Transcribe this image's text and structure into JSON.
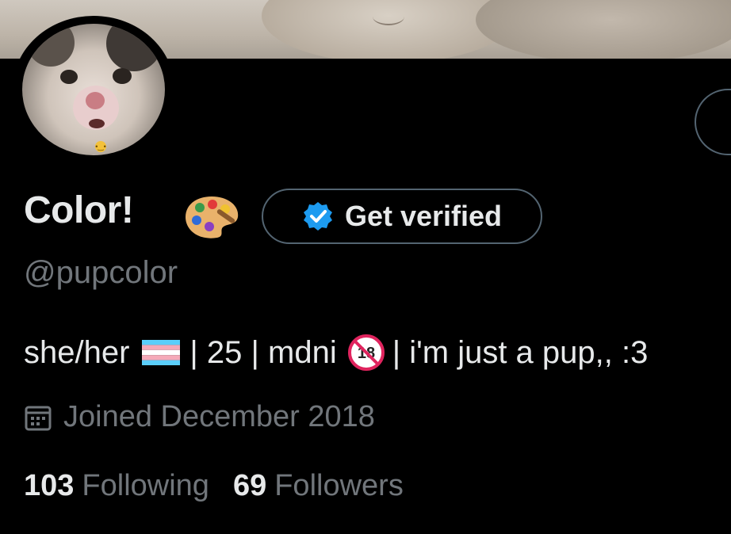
{
  "profile": {
    "display_name": "Color!",
    "name_emoji": "artist-palette",
    "handle": "@pupcolor",
    "verify_button": "Get verified",
    "bio": {
      "pronouns": "she/her",
      "flag": "transgender-flag",
      "age_part": "| 25 | mdni",
      "no18_icon": "no-one-under-eighteen",
      "tail": "| i'm just a pup,, :3"
    },
    "joined": "Joined December 2018",
    "stats": {
      "following_count": "103",
      "following_label": "Following",
      "followers_count": "69",
      "followers_label": "Followers"
    }
  },
  "colors": {
    "background": "#000000",
    "primary_text": "#e7e9ea",
    "secondary_text": "#71767b",
    "border": "#536471",
    "verified_blue": "#1d9bf0"
  }
}
